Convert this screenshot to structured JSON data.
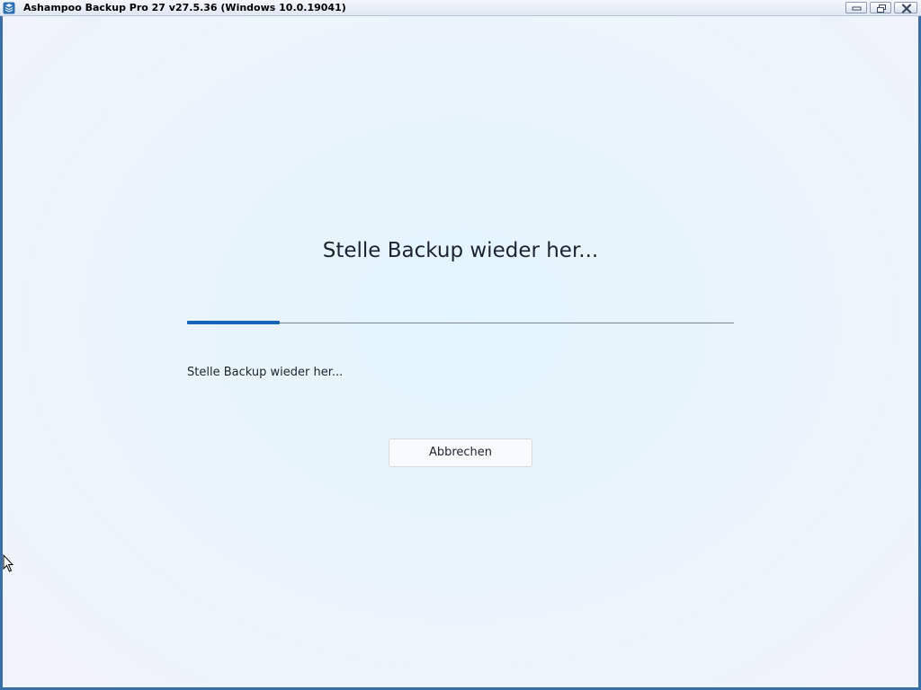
{
  "window": {
    "title": "Ashampoo Backup Pro 27 v27.5.36 (Windows 10.0.19041)",
    "icon": "app-backup-icon",
    "controls": [
      "minimize-icon",
      "restore-icon",
      "close-icon"
    ]
  },
  "main": {
    "heading": "Stelle Backup wieder her...",
    "progress": {
      "fraction": 0.17
    },
    "status_text": "Stelle Backup wieder her...",
    "cancel_label": "Abbrechen"
  },
  "colors": {
    "progress_fill": "#1565b8",
    "progress_track": "#7e8791",
    "text": "#1d2230"
  }
}
